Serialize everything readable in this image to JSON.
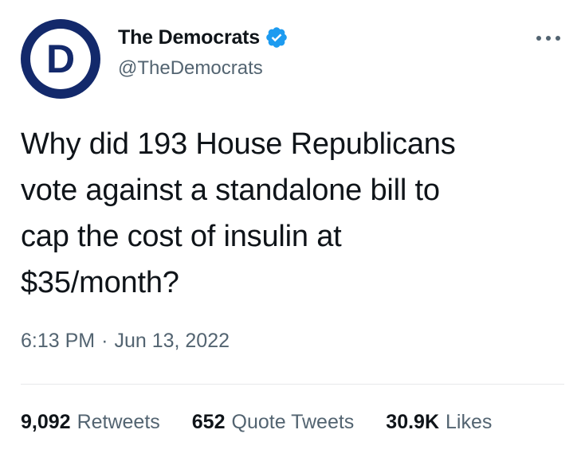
{
  "author": {
    "display_name": "The Democrats",
    "handle": "@TheDemocrats",
    "avatar_letter": "D",
    "avatar_color": "#13296b",
    "verified_color": "#1d9bf0"
  },
  "tweet": {
    "text": "Why did 193 House Republicans\nvote against a standalone bill to\ncap the cost of insulin at\n$35/month?",
    "time": "6:13 PM",
    "separator": "·",
    "date": "Jun 13, 2022"
  },
  "stats": [
    {
      "count": "9,092",
      "label": "Retweets"
    },
    {
      "count": "652",
      "label": "Quote Tweets"
    },
    {
      "count": "30.9K",
      "label": "Likes"
    }
  ],
  "icons": {
    "more": "more-options-icon",
    "verified": "verified-badge-icon"
  }
}
